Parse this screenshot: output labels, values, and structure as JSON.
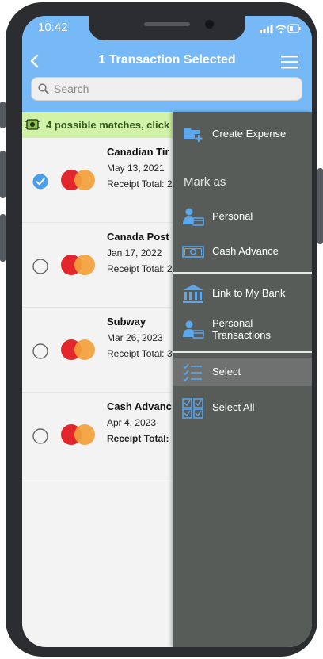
{
  "status_bar": {
    "time": "10:42"
  },
  "header": {
    "title": "1 Transaction Selected"
  },
  "search": {
    "placeholder": "Search"
  },
  "banner": {
    "text": "4 possible matches, click"
  },
  "transactions": [
    {
      "merchant": "Canadian Tir",
      "date": "May 13, 2021",
      "receipt": "Receipt Total: 2",
      "selected": true
    },
    {
      "merchant": "Canada Post",
      "date": "Jan 17, 2022",
      "receipt": "Receipt Total: 2",
      "selected": false
    },
    {
      "merchant": "Subway",
      "date": "Mar 26, 2023",
      "receipt": "Receipt Total: 3",
      "selected": false
    },
    {
      "merchant": "Cash Advanc",
      "date": "Apr 4, 2023",
      "receipt": "Receipt Total:",
      "selected": false
    }
  ],
  "drawer": {
    "create_expense": "Create Expense",
    "mark_as": "Mark as",
    "personal": "Personal",
    "cash_advance": "Cash Advance",
    "link_bank": "Link to My Bank",
    "personal_transactions_1": "Personal",
    "personal_transactions_2": "Transactions",
    "select": "Select",
    "select_all": "Select All"
  },
  "colors": {
    "header": "#76b9f6",
    "accent": "#4a9eee",
    "banner": "#d1f3a8",
    "drawer": "#585c58"
  }
}
